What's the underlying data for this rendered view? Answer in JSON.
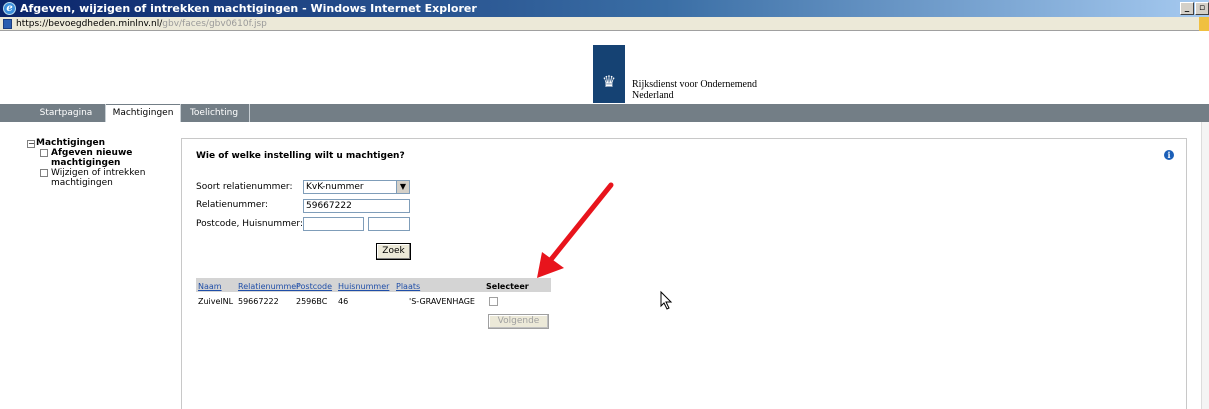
{
  "window": {
    "title": "Afgeven, wijzigen of intrekken machtigingen - Windows Internet Explorer",
    "buttons": [
      "_",
      "▫"
    ]
  },
  "address": {
    "host": "https://bevoegdheden.minlnv.nl/",
    "path": "gbv/faces/gbv0610f.jsp"
  },
  "header": {
    "org_line1": "Rijksdienst voor Ondernemend",
    "org_line2": "Nederland",
    "brand_color": "#154273"
  },
  "nav": {
    "tabs": [
      {
        "label": "Startpagina",
        "active": false
      },
      {
        "label": "Machtigingen",
        "active": true
      },
      {
        "label": "Toelichting",
        "active": false
      }
    ]
  },
  "tree": {
    "root": "Machtigingen",
    "root_marker": "−",
    "children": [
      {
        "label": "Afgeven nieuwe machtigingen",
        "selected": true
      },
      {
        "label": "Wijzigen of intrekken machtigingen",
        "selected": false
      }
    ]
  },
  "form": {
    "title": "Wie of welke instelling wilt u machtigen?",
    "relation_type_label": "Soort relatienummer:",
    "relation_type_value": "KvK-nummer",
    "relation_number_label": "Relatienummer:",
    "relation_number_value": "59667222",
    "postcode_label": "Postcode, Huisnummer:",
    "postcode_value": "",
    "housenumber_value": "",
    "search_button": "Zoek",
    "info_icon_glyph": "i"
  },
  "results": {
    "columns": [
      "Naam",
      "Relatienummer",
      "Postcode",
      "Huisnummer",
      "Plaats",
      "Selecteer"
    ],
    "rows": [
      {
        "naam": "ZuivelNL",
        "relatienummer": "59667222",
        "postcode": "2596BC",
        "huisnummer": "46",
        "plaats": "'S-GRAVENHAGE",
        "selected": false
      }
    ],
    "next_button": "Volgende"
  },
  "annotation": {
    "arrow_color": "#e8141c"
  }
}
